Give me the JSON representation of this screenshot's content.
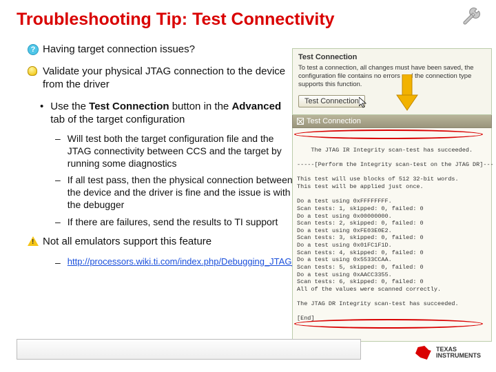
{
  "title": "Troubleshooting Tip: Test Connectivity",
  "q1": "Having target connection issues?",
  "bulb1": "Validate your physical JTAG connection to the device from the driver",
  "bullet1_pre": "Use the ",
  "bullet1_b1": "Test Connection",
  "bullet1_mid": " button in the ",
  "bullet1_b2": "Advanced",
  "bullet1_post": " tab of the target configuration",
  "sub_a": "Will test both the target configuration file and the JTAG connectivity between CCS and the target by running some diagnostics",
  "sub_b": "If all test pass, then the physical connection between the device and the driver is fine and the issue is with the debugger",
  "sub_c": "If there are failures, send the results to TI support",
  "warn1": "Not all emulators support this feature",
  "link": "http://processors.wiki.ti.com/index.php/Debugging_JTAG_Connectivity_Problems",
  "panel": {
    "title": "Test Connection",
    "desc": "To test a connection, all changes must have been saved, the configuration file contains no errors and the connection type supports this function.",
    "button": "Test Connection",
    "bar": "Test Connection"
  },
  "console_text": "The JTAG IR Integrity scan-test has succeeded.\n\n-----[Perform the Integrity scan-test on the JTAG DR]---\n\nThis test will use blocks of 512 32-bit words.\nThis test will be applied just once.\n\nDo a test using 0xFFFFFFFF.\nScan tests: 1, skipped: 0, failed: 0\nDo a test using 0x00000000.\nScan tests: 2, skipped: 0, failed: 0\nDo a test using 0xFE03E0E2.\nScan tests: 3, skipped: 0, failed: 0\nDo a test using 0x01FC1F1D.\nScan tests: 4, skipped: 0, failed: 0\nDo a test using 0x5533CCAA.\nScan tests: 5, skipped: 0, failed: 0\nDo a test using 0xAACC3355.\nScan tests: 6, skipped: 0, failed: 0\nAll of the values were scanned correctly.\n\nThe JTAG DR Integrity scan-test has succeeded.\n\n[End]",
  "logo": {
    "line1": "TEXAS",
    "line2": "INSTRUMENTS"
  }
}
